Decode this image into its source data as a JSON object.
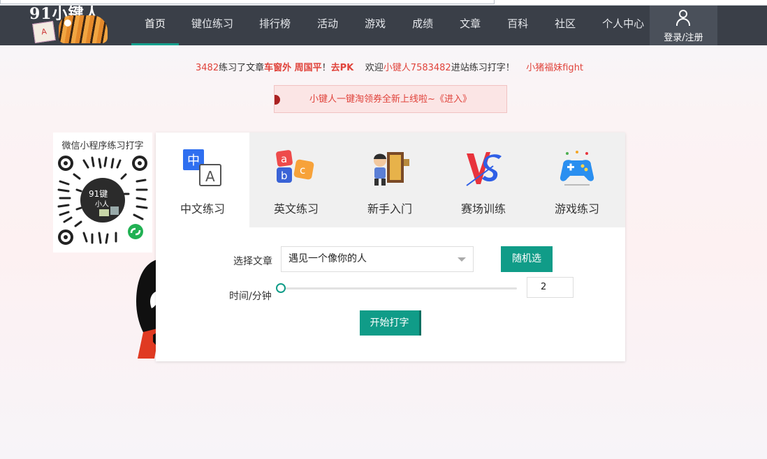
{
  "nav": {
    "logo_text": "91小键人",
    "items": [
      "首页",
      "键位练习",
      "排行榜",
      "活动",
      "游戏",
      "成绩",
      "文章",
      "百科",
      "社区",
      "个人中心"
    ],
    "login_label": "登录/注册"
  },
  "ticker": {
    "segments": [
      {
        "text": "3482",
        "style": "red"
      },
      {
        "text": "练习了文章",
        "style": "plain"
      },
      {
        "text": "车窗外 周国平",
        "style": "red-bold"
      },
      {
        "text": "！",
        "style": "plain"
      },
      {
        "text": "去PK",
        "style": "red-bold"
      },
      {
        "text": "    欢迎",
        "style": "plain"
      },
      {
        "text": "小键人7583482",
        "style": "red"
      },
      {
        "text": "进站练习打字！",
        "style": "plain"
      },
      {
        "text": "    小猪福妹fight",
        "style": "red"
      }
    ]
  },
  "banner": {
    "text": "小键人一键淘领券全新上线啦~《进入》"
  },
  "qr_card": {
    "title": "微信小程序练习打字"
  },
  "tabs": [
    {
      "label": "中文练习",
      "icon": "chinese-practice-icon"
    },
    {
      "label": "英文练习",
      "icon": "english-abc-icon"
    },
    {
      "label": "新手入门",
      "icon": "beginner-door-icon"
    },
    {
      "label": "赛场训练",
      "icon": "vs-icon"
    },
    {
      "label": "游戏练习",
      "icon": "gamepad-icon"
    }
  ],
  "form": {
    "article_label": "选择文章",
    "article_value": "遇见一个像你的人",
    "random_button": "随机选",
    "time_label": "时间/分钟",
    "time_value": "2",
    "slider_fraction": 0.0,
    "start_button": "开始打字"
  },
  "colors": {
    "accent": "#109c88",
    "nav_bg": "#3a3f48",
    "highlight": "#e0433b"
  }
}
